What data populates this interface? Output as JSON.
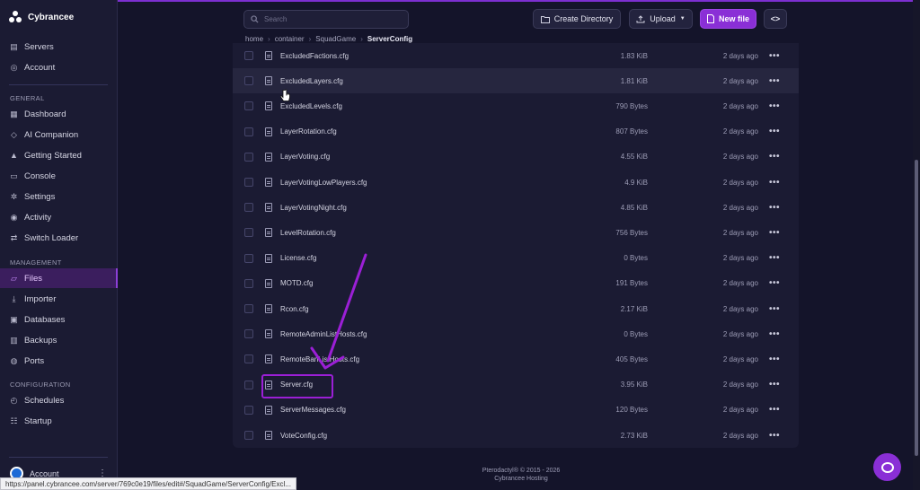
{
  "brand": {
    "name": "Cybrancee"
  },
  "sidebar": {
    "top_items": [
      {
        "label": "Servers",
        "icon": "server-icon"
      },
      {
        "label": "Account",
        "icon": "user-circle-icon"
      }
    ],
    "sections": [
      {
        "title": "GENERAL"
      },
      {
        "title": "MANAGEMENT"
      },
      {
        "title": "CONFIGURATION"
      }
    ],
    "general_items": [
      {
        "label": "Dashboard",
        "icon": "grid-icon"
      },
      {
        "label": "AI Companion",
        "icon": "chat-icon"
      },
      {
        "label": "Getting Started",
        "icon": "rocket-icon"
      },
      {
        "label": "Console",
        "icon": "terminal-icon"
      },
      {
        "label": "Settings",
        "icon": "gear-icon"
      },
      {
        "label": "Activity",
        "icon": "eye-icon"
      },
      {
        "label": "Switch Loader",
        "icon": "swap-icon"
      }
    ],
    "management_items": [
      {
        "label": "Files",
        "icon": "folder-icon",
        "active": true
      },
      {
        "label": "Importer",
        "icon": "download-icon"
      },
      {
        "label": "Databases",
        "icon": "database-icon"
      },
      {
        "label": "Backups",
        "icon": "archive-icon"
      },
      {
        "label": "Ports",
        "icon": "globe-icon"
      }
    ],
    "configuration_items": [
      {
        "label": "Schedules",
        "icon": "clock-icon"
      },
      {
        "label": "Startup",
        "icon": "sliders-icon"
      }
    ],
    "account_label": "Account"
  },
  "toolbar": {
    "search_placeholder": "Search",
    "create_directory": "Create Directory",
    "upload": "Upload",
    "new_file": "New file"
  },
  "breadcrumb": [
    "home",
    "container",
    "SquadGame",
    "ServerConfig"
  ],
  "files": [
    {
      "name": "ExcludedFactions.cfg",
      "size": "1.83 KiB",
      "date": "2 days ago"
    },
    {
      "name": "ExcludedLayers.cfg",
      "size": "1.81 KiB",
      "date": "2 days ago"
    },
    {
      "name": "ExcludedLevels.cfg",
      "size": "790 Bytes",
      "date": "2 days ago"
    },
    {
      "name": "LayerRotation.cfg",
      "size": "807 Bytes",
      "date": "2 days ago"
    },
    {
      "name": "LayerVoting.cfg",
      "size": "4.55 KiB",
      "date": "2 days ago"
    },
    {
      "name": "LayerVotingLowPlayers.cfg",
      "size": "4.9 KiB",
      "date": "2 days ago"
    },
    {
      "name": "LayerVotingNight.cfg",
      "size": "4.85 KiB",
      "date": "2 days ago"
    },
    {
      "name": "LevelRotation.cfg",
      "size": "756 Bytes",
      "date": "2 days ago"
    },
    {
      "name": "License.cfg",
      "size": "0 Bytes",
      "date": "2 days ago"
    },
    {
      "name": "MOTD.cfg",
      "size": "191 Bytes",
      "date": "2 days ago"
    },
    {
      "name": "Rcon.cfg",
      "size": "2.17 KiB",
      "date": "2 days ago"
    },
    {
      "name": "RemoteAdminListHosts.cfg",
      "size": "0 Bytes",
      "date": "2 days ago"
    },
    {
      "name": "RemoteBanListHosts.cfg",
      "size": "405 Bytes",
      "date": "2 days ago"
    },
    {
      "name": "Server.cfg",
      "size": "3.95 KiB",
      "date": "2 days ago"
    },
    {
      "name": "ServerMessages.cfg",
      "size": "120 Bytes",
      "date": "2 days ago"
    },
    {
      "name": "VoteConfig.cfg",
      "size": "2.73 KiB",
      "date": "2 days ago"
    }
  ],
  "row_menu_glyph": "•••",
  "footer": {
    "line1": "Pterodactyl® © 2015 - 2026",
    "line2": "Cybrancee Hosting"
  },
  "status_url": "https://panel.cybrancee.com/server/769c0e19/files/edit#/SquadGame/ServerConfig/Excl...",
  "colors": {
    "accent": "#8a2fd6",
    "annotation": "#9b1fd6",
    "background": "#14142a"
  }
}
